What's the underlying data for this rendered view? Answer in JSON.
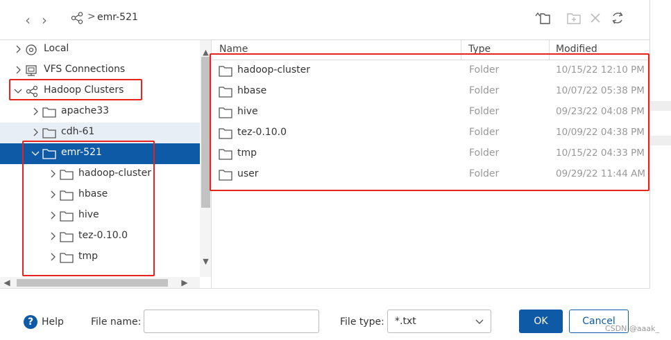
{
  "breadcrumb": {
    "icon": "cluster-icon",
    "separator": ">",
    "current": "emr-521"
  },
  "nav": {
    "back": "‹",
    "forward": "›"
  },
  "toolbar": {
    "icons": [
      "parent-folder-icon",
      "new-folder-icon",
      "delete-icon",
      "refresh-icon"
    ]
  },
  "tree": {
    "items": [
      {
        "label": "Local",
        "icon": "local-icon",
        "expanded": false
      },
      {
        "label": "VFS Connections",
        "icon": "vfs-icon",
        "expanded": false
      },
      {
        "label": "Hadoop Clusters",
        "icon": "cluster-icon",
        "expanded": true
      },
      {
        "label": "apache33",
        "icon": "folder-icon",
        "expanded": false
      },
      {
        "label": "cdh-61",
        "icon": "folder-icon",
        "expanded": false,
        "hover": true
      },
      {
        "label": "emr-521",
        "icon": "folder-icon",
        "expanded": true,
        "selected": true
      },
      {
        "label": "hadoop-cluster",
        "icon": "folder-icon",
        "expanded": false
      },
      {
        "label": "hbase",
        "icon": "folder-icon",
        "expanded": false
      },
      {
        "label": "hive",
        "icon": "folder-icon",
        "expanded": false
      },
      {
        "label": "tez-0.10.0",
        "icon": "folder-icon",
        "expanded": false
      },
      {
        "label": "tmp",
        "icon": "folder-icon",
        "expanded": false
      }
    ]
  },
  "list": {
    "columns": [
      "Name",
      "Type",
      "Modified"
    ],
    "rows": [
      {
        "name": "hadoop-cluster",
        "type": "Folder",
        "modified": "10/15/22 12:10 PM"
      },
      {
        "name": "hbase",
        "type": "Folder",
        "modified": "10/07/22 05:38 PM"
      },
      {
        "name": "hive",
        "type": "Folder",
        "modified": "09/23/22 04:08 PM"
      },
      {
        "name": "tez-0.10.0",
        "type": "Folder",
        "modified": "10/09/22 04:38 PM"
      },
      {
        "name": "tmp",
        "type": "Folder",
        "modified": "10/15/22 04:33 PM"
      },
      {
        "name": "user",
        "type": "Folder",
        "modified": "09/29/22 11:44 AM"
      }
    ]
  },
  "footer": {
    "help_label": "Help",
    "help_icon": "?",
    "file_name_label": "File name:",
    "file_name_value": "",
    "file_type_label": "File type:",
    "file_type_value": "*.txt",
    "ok_label": "OK",
    "cancel_label": "Cancel"
  },
  "watermark": "CSDN @aaak_",
  "colors": {
    "accent": "#0f5aa6",
    "selection": "#0f5aa6",
    "hover": "#e8eef6",
    "annotation": "#e8231b"
  }
}
